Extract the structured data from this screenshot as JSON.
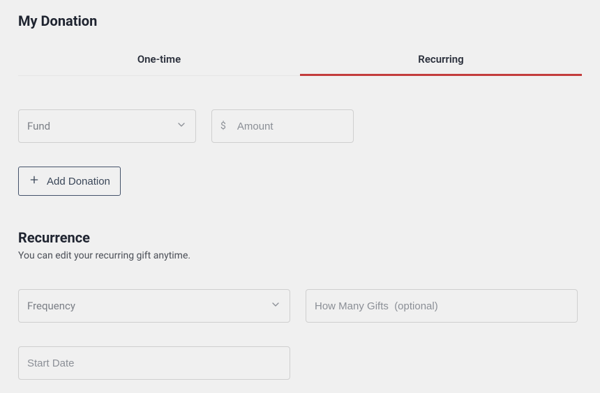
{
  "headings": {
    "donation": "My Donation",
    "recurrence": "Recurrence",
    "recurrence_sub": "You can edit your recurring gift anytime."
  },
  "tabs": {
    "one_time": "One-time",
    "recurring": "Recurring",
    "active": "recurring"
  },
  "fields": {
    "fund_placeholder": "Fund",
    "amount_prefix": "$",
    "amount_placeholder": "Amount",
    "frequency_placeholder": "Frequency",
    "how_many_placeholder": "How Many Gifts  (optional)",
    "start_date_placeholder": "Start Date"
  },
  "buttons": {
    "add_donation": "Add Donation"
  }
}
